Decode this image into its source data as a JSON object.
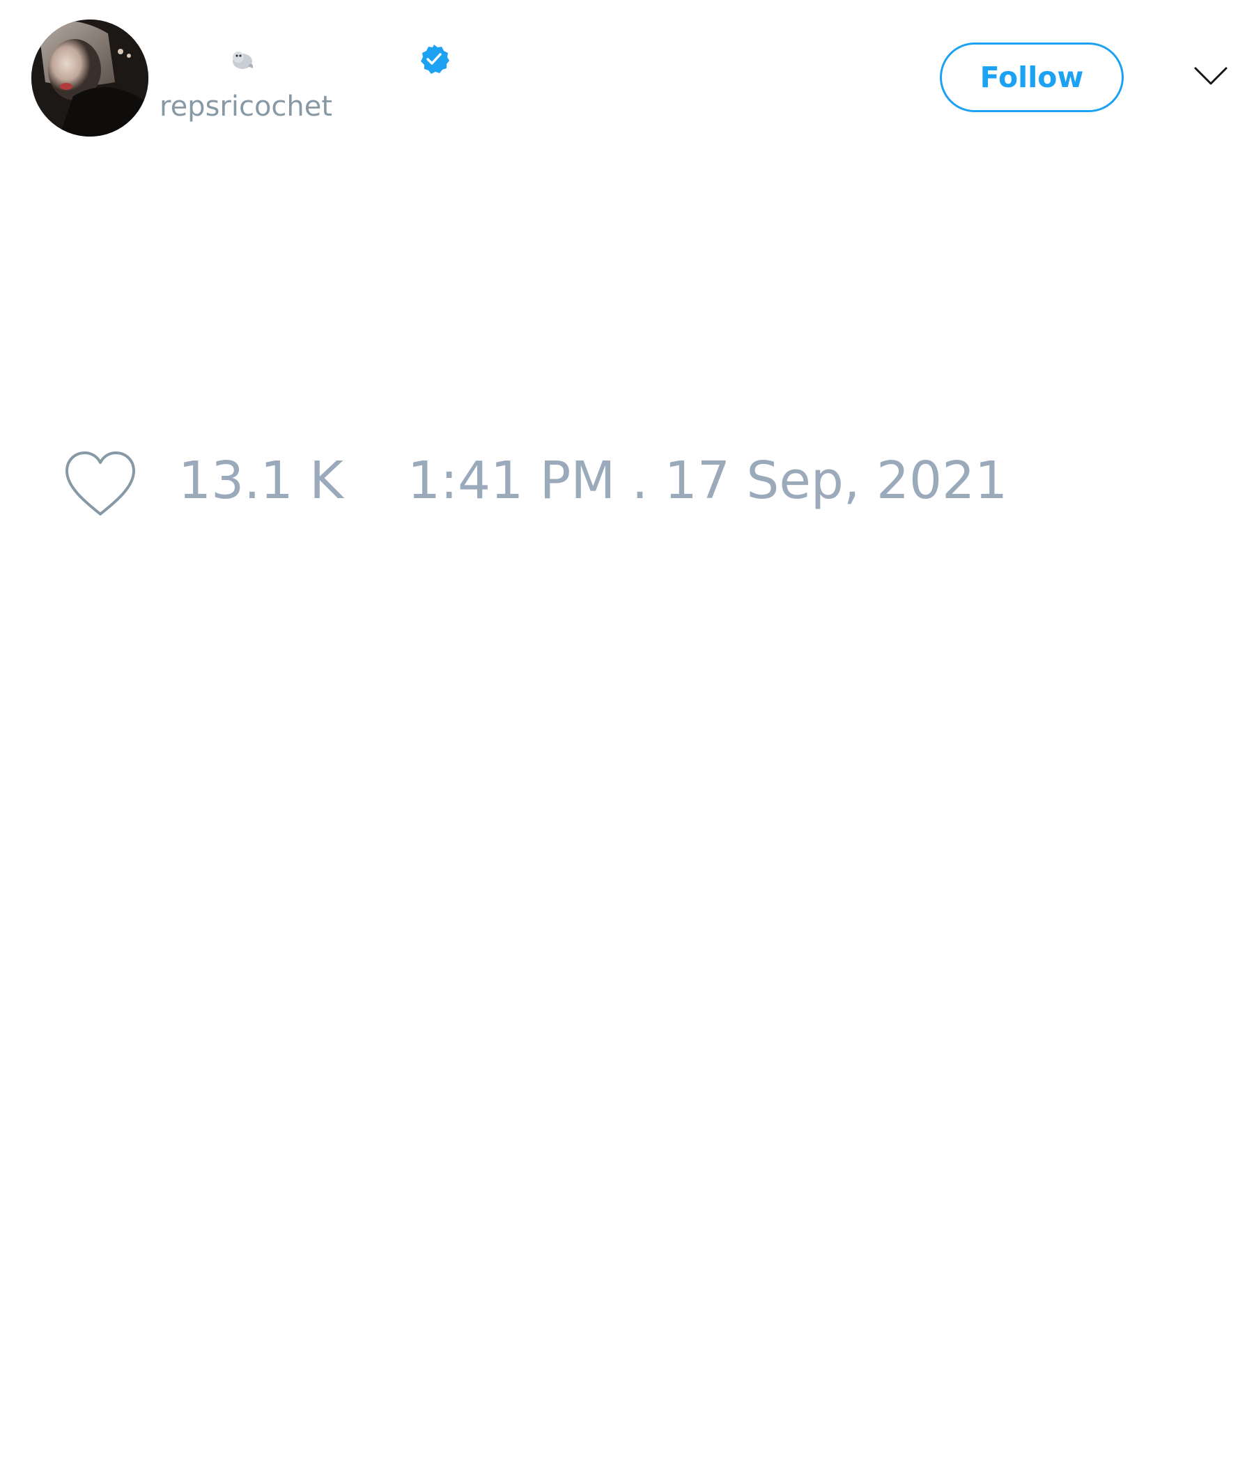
{
  "author": {
    "display_name_icon": "seal-emoji",
    "verified_icon": "verified-badge-icon",
    "handle": "repsricochet"
  },
  "actions": {
    "follow_label": "Follow",
    "menu_icon": "chevron-down-icon"
  },
  "stats": {
    "like_icon": "heart-icon",
    "like_count": "13.1 K",
    "timestamp": "1:41 PM . 17 Sep, 2021"
  },
  "colors": {
    "accent": "#1da1f2",
    "muted_text": "#8899a6",
    "stat_text": "#9aaabb",
    "background": "#ffffff"
  }
}
